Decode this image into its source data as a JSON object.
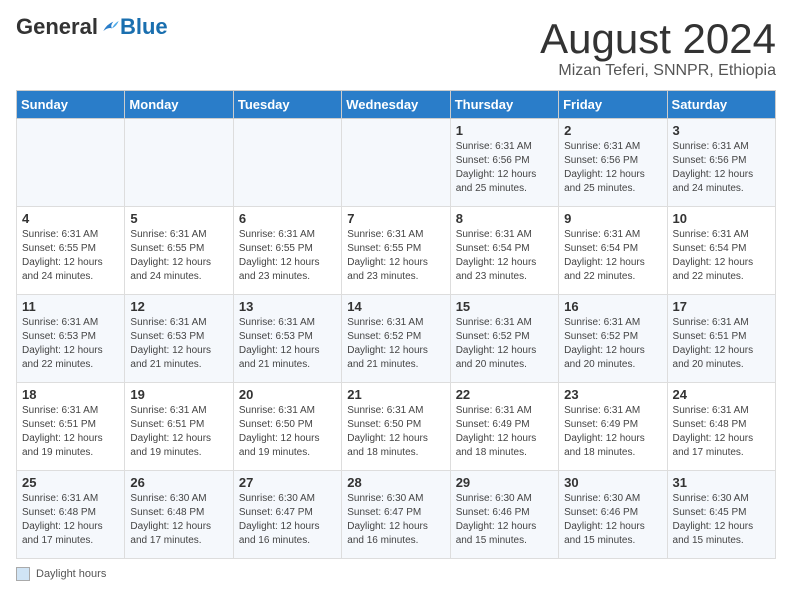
{
  "header": {
    "logo_general": "General",
    "logo_blue": "Blue",
    "title": "August 2024",
    "subtitle": "Mizan Teferi, SNNPR, Ethiopia"
  },
  "days_of_week": [
    "Sunday",
    "Monday",
    "Tuesday",
    "Wednesday",
    "Thursday",
    "Friday",
    "Saturday"
  ],
  "weeks": [
    [
      {
        "day": "",
        "info": ""
      },
      {
        "day": "",
        "info": ""
      },
      {
        "day": "",
        "info": ""
      },
      {
        "day": "",
        "info": ""
      },
      {
        "day": "1",
        "info": "Sunrise: 6:31 AM\nSunset: 6:56 PM\nDaylight: 12 hours\nand 25 minutes."
      },
      {
        "day": "2",
        "info": "Sunrise: 6:31 AM\nSunset: 6:56 PM\nDaylight: 12 hours\nand 25 minutes."
      },
      {
        "day": "3",
        "info": "Sunrise: 6:31 AM\nSunset: 6:56 PM\nDaylight: 12 hours\nand 24 minutes."
      }
    ],
    [
      {
        "day": "4",
        "info": "Sunrise: 6:31 AM\nSunset: 6:55 PM\nDaylight: 12 hours\nand 24 minutes."
      },
      {
        "day": "5",
        "info": "Sunrise: 6:31 AM\nSunset: 6:55 PM\nDaylight: 12 hours\nand 24 minutes."
      },
      {
        "day": "6",
        "info": "Sunrise: 6:31 AM\nSunset: 6:55 PM\nDaylight: 12 hours\nand 23 minutes."
      },
      {
        "day": "7",
        "info": "Sunrise: 6:31 AM\nSunset: 6:55 PM\nDaylight: 12 hours\nand 23 minutes."
      },
      {
        "day": "8",
        "info": "Sunrise: 6:31 AM\nSunset: 6:54 PM\nDaylight: 12 hours\nand 23 minutes."
      },
      {
        "day": "9",
        "info": "Sunrise: 6:31 AM\nSunset: 6:54 PM\nDaylight: 12 hours\nand 22 minutes."
      },
      {
        "day": "10",
        "info": "Sunrise: 6:31 AM\nSunset: 6:54 PM\nDaylight: 12 hours\nand 22 minutes."
      }
    ],
    [
      {
        "day": "11",
        "info": "Sunrise: 6:31 AM\nSunset: 6:53 PM\nDaylight: 12 hours\nand 22 minutes."
      },
      {
        "day": "12",
        "info": "Sunrise: 6:31 AM\nSunset: 6:53 PM\nDaylight: 12 hours\nand 21 minutes."
      },
      {
        "day": "13",
        "info": "Sunrise: 6:31 AM\nSunset: 6:53 PM\nDaylight: 12 hours\nand 21 minutes."
      },
      {
        "day": "14",
        "info": "Sunrise: 6:31 AM\nSunset: 6:52 PM\nDaylight: 12 hours\nand 21 minutes."
      },
      {
        "day": "15",
        "info": "Sunrise: 6:31 AM\nSunset: 6:52 PM\nDaylight: 12 hours\nand 20 minutes."
      },
      {
        "day": "16",
        "info": "Sunrise: 6:31 AM\nSunset: 6:52 PM\nDaylight: 12 hours\nand 20 minutes."
      },
      {
        "day": "17",
        "info": "Sunrise: 6:31 AM\nSunset: 6:51 PM\nDaylight: 12 hours\nand 20 minutes."
      }
    ],
    [
      {
        "day": "18",
        "info": "Sunrise: 6:31 AM\nSunset: 6:51 PM\nDaylight: 12 hours\nand 19 minutes."
      },
      {
        "day": "19",
        "info": "Sunrise: 6:31 AM\nSunset: 6:51 PM\nDaylight: 12 hours\nand 19 minutes."
      },
      {
        "day": "20",
        "info": "Sunrise: 6:31 AM\nSunset: 6:50 PM\nDaylight: 12 hours\nand 19 minutes."
      },
      {
        "day": "21",
        "info": "Sunrise: 6:31 AM\nSunset: 6:50 PM\nDaylight: 12 hours\nand 18 minutes."
      },
      {
        "day": "22",
        "info": "Sunrise: 6:31 AM\nSunset: 6:49 PM\nDaylight: 12 hours\nand 18 minutes."
      },
      {
        "day": "23",
        "info": "Sunrise: 6:31 AM\nSunset: 6:49 PM\nDaylight: 12 hours\nand 18 minutes."
      },
      {
        "day": "24",
        "info": "Sunrise: 6:31 AM\nSunset: 6:48 PM\nDaylight: 12 hours\nand 17 minutes."
      }
    ],
    [
      {
        "day": "25",
        "info": "Sunrise: 6:31 AM\nSunset: 6:48 PM\nDaylight: 12 hours\nand 17 minutes."
      },
      {
        "day": "26",
        "info": "Sunrise: 6:30 AM\nSunset: 6:48 PM\nDaylight: 12 hours\nand 17 minutes."
      },
      {
        "day": "27",
        "info": "Sunrise: 6:30 AM\nSunset: 6:47 PM\nDaylight: 12 hours\nand 16 minutes."
      },
      {
        "day": "28",
        "info": "Sunrise: 6:30 AM\nSunset: 6:47 PM\nDaylight: 12 hours\nand 16 minutes."
      },
      {
        "day": "29",
        "info": "Sunrise: 6:30 AM\nSunset: 6:46 PM\nDaylight: 12 hours\nand 15 minutes."
      },
      {
        "day": "30",
        "info": "Sunrise: 6:30 AM\nSunset: 6:46 PM\nDaylight: 12 hours\nand 15 minutes."
      },
      {
        "day": "31",
        "info": "Sunrise: 6:30 AM\nSunset: 6:45 PM\nDaylight: 12 hours\nand 15 minutes."
      }
    ]
  ],
  "footer": {
    "legend_label": "Daylight hours"
  }
}
